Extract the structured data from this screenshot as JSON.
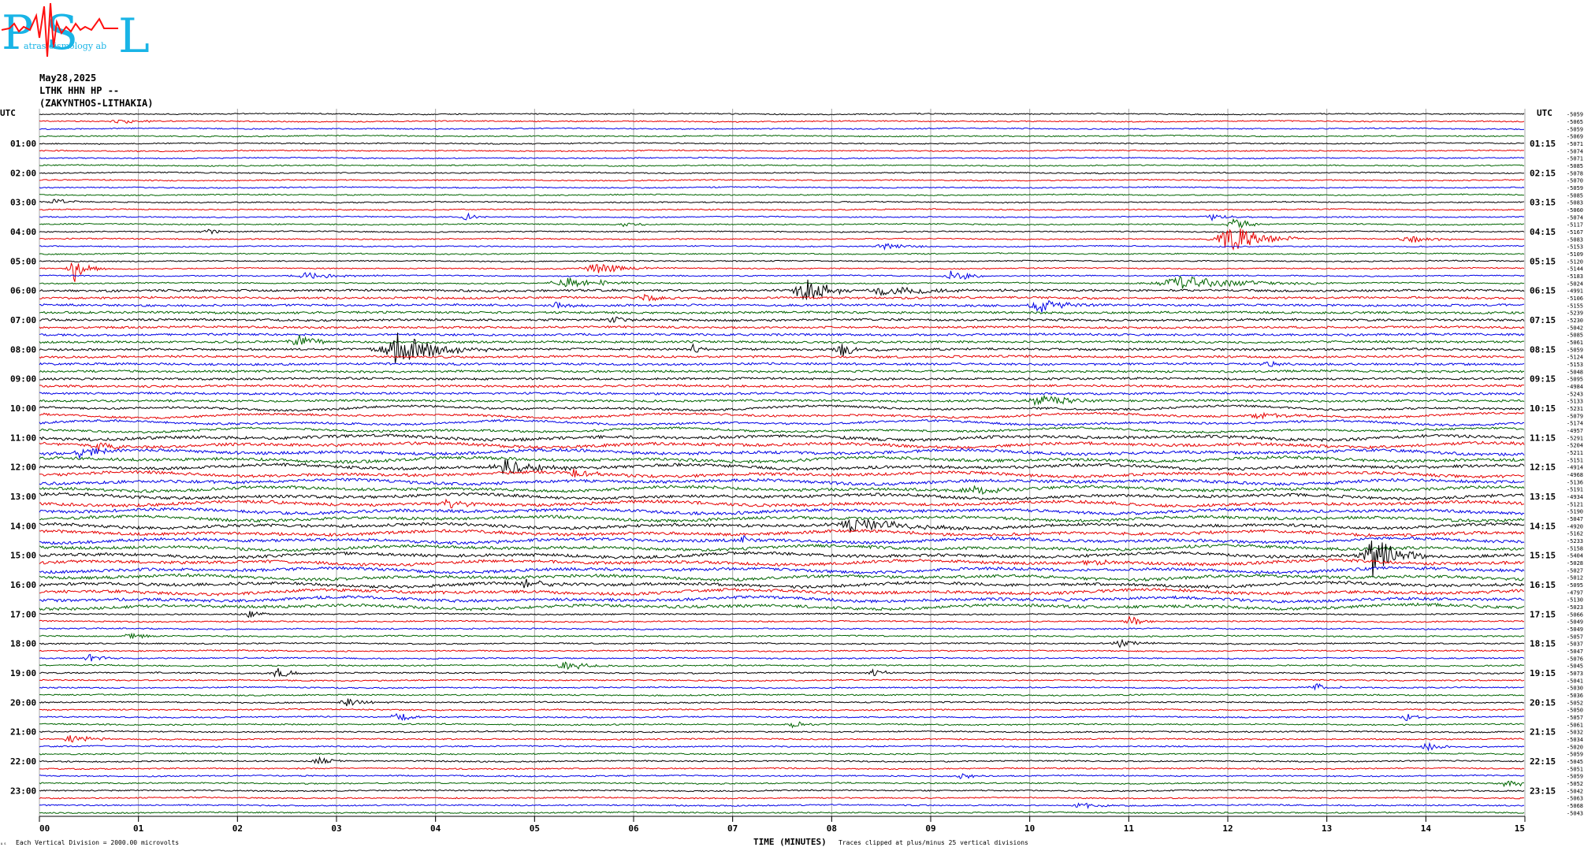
{
  "logo": {
    "letters": [
      "P",
      "S",
      "L"
    ],
    "subtitle": "atras   eismology   ab",
    "colors": {
      "letters": "#19b4e6",
      "trace": "#ff1010"
    }
  },
  "header": {
    "date": "May28,2025",
    "station": "LTHK HHN HP --",
    "location": "(ZAKYNTHOS-LITHAKIA)"
  },
  "axis_corner_labels": {
    "left": "UTC",
    "right": "UTC"
  },
  "footer": {
    "left_mark": "ᵤₛ",
    "division_note": "Each Vertical Division = 2000.00 microvolts",
    "xlabel": "TIME (MINUTES)",
    "clip_note": "Traces clipped at plus/minus 25 vertical divisions"
  },
  "chart_data": {
    "type": "line",
    "title": "LTHK HHN HP --",
    "xlabel": "TIME (MINUTES)",
    "xlim": [
      0,
      15
    ],
    "x_ticks": [
      "00",
      "01",
      "02",
      "03",
      "04",
      "05",
      "06",
      "07",
      "08",
      "09",
      "10",
      "11",
      "12",
      "13",
      "14",
      "15"
    ],
    "row_minutes": 15,
    "row_colors": [
      "#000000",
      "#e60000",
      "#0000e6",
      "#006400"
    ],
    "left_time_labels": [
      "01:00",
      "02:00",
      "03:00",
      "04:00",
      "05:00",
      "06:00",
      "07:00",
      "08:00",
      "09:00",
      "10:00",
      "11:00",
      "12:00",
      "13:00",
      "14:00",
      "15:00",
      "16:00",
      "17:00",
      "18:00",
      "19:00",
      "20:00",
      "21:00",
      "22:00",
      "23:00"
    ],
    "right_time_labels": [
      "01:15",
      "02:15",
      "03:15",
      "04:15",
      "05:15",
      "06:15",
      "07:15",
      "08:15",
      "09:15",
      "10:15",
      "11:15",
      "12:15",
      "13:15",
      "14:15",
      "15:15",
      "16:15",
      "17:15",
      "18:15",
      "19:15",
      "20:15",
      "21:15",
      "22:15",
      "23:15"
    ],
    "row_offsets": [
      "-5059",
      "-5065",
      "-5059",
      "-5069",
      "-5071",
      "-5074",
      "-5071",
      "-5085",
      "-5078",
      "-5070",
      "-5059",
      "-5085",
      "-5083",
      "-5060",
      "-5074",
      "-5117",
      "-5167",
      "-5083",
      "-5153",
      "-5109",
      "-5120",
      "-5144",
      "-5183",
      "-5024",
      "-4991",
      "-5106",
      "-5155",
      "-5239",
      "-5230",
      "-5042",
      "-5085",
      "-5061",
      "-5059",
      "-5124",
      "-5153",
      "-5048",
      "-5095",
      "-4984",
      "-5243",
      "-5133",
      "-5231",
      "-5079",
      "-5174",
      "-4957",
      "-5291",
      "-5204",
      "-5211",
      "-5151",
      "-4914",
      "-4968",
      "-5136",
      "-5191",
      "-4934",
      "-5121",
      "-5190",
      "-5047",
      "-4920",
      "-5162",
      "-5233",
      "-5158",
      "-5404",
      "-5028",
      "-5027",
      "-5012",
      "-5095",
      "-4797",
      "-5130",
      "-5023",
      "-5066",
      "-5049",
      "-5049",
      "-5057",
      "-5037",
      "-5047",
      "-5076",
      "-5045",
      "-5073",
      "-5041",
      "-5030",
      "-5036",
      "-5052",
      "-5050",
      "-5057",
      "-5061",
      "-5032",
      "-5034",
      "-5020",
      "-5059",
      "-5045",
      "-5051",
      "-5059",
      "-5052",
      "-5042",
      "-5063",
      "-5068",
      "-5043"
    ],
    "events": [
      {
        "row": 1,
        "minute": 0.8,
        "amp": 3,
        "dur": 0.6
      },
      {
        "row": 12,
        "minute": 0.15,
        "amp": 5,
        "dur": 0.3
      },
      {
        "row": 14,
        "minute": 11.8,
        "amp": 5,
        "dur": 0.4
      },
      {
        "row": 14,
        "minute": 4.3,
        "amp": 7,
        "dur": 0.2
      },
      {
        "row": 15,
        "minute": 12.05,
        "amp": 8,
        "dur": 0.4
      },
      {
        "row": 15,
        "minute": 5.9,
        "amp": 4,
        "dur": 0.3
      },
      {
        "row": 16,
        "minute": 1.7,
        "amp": 4,
        "dur": 0.3
      },
      {
        "row": 17,
        "minute": 12.0,
        "amp": 22,
        "dur": 0.7
      },
      {
        "row": 17,
        "minute": 13.8,
        "amp": 6,
        "dur": 0.5
      },
      {
        "row": 18,
        "minute": 8.5,
        "amp": 5,
        "dur": 0.5
      },
      {
        "row": 21,
        "minute": 0.35,
        "amp": 18,
        "dur": 0.3
      },
      {
        "row": 21,
        "minute": 5.6,
        "amp": 8,
        "dur": 0.7
      },
      {
        "row": 22,
        "minute": 2.7,
        "amp": 5,
        "dur": 0.8
      },
      {
        "row": 22,
        "minute": 9.2,
        "amp": 9,
        "dur": 0.4
      },
      {
        "row": 23,
        "minute": 5.3,
        "amp": 8,
        "dur": 0.9
      },
      {
        "row": 23,
        "minute": 11.5,
        "amp": 9,
        "dur": 1.5
      },
      {
        "row": 24,
        "minute": 7.7,
        "amp": 22,
        "dur": 0.5
      },
      {
        "row": 24,
        "minute": 8.5,
        "amp": 6,
        "dur": 1.2
      },
      {
        "row": 25,
        "minute": 6.1,
        "amp": 5,
        "dur": 0.4
      },
      {
        "row": 26,
        "minute": 10.1,
        "amp": 9,
        "dur": 0.6
      },
      {
        "row": 26,
        "minute": 5.2,
        "amp": 5,
        "dur": 0.3
      },
      {
        "row": 28,
        "minute": 5.8,
        "amp": 4,
        "dur": 0.5
      },
      {
        "row": 31,
        "minute": 2.6,
        "amp": 9,
        "dur": 0.4
      },
      {
        "row": 32,
        "minute": 3.6,
        "amp": 24,
        "dur": 0.9
      },
      {
        "row": 32,
        "minute": 8.1,
        "amp": 10,
        "dur": 0.4
      },
      {
        "row": 32,
        "minute": 6.6,
        "amp": 6,
        "dur": 0.2
      },
      {
        "row": 34,
        "minute": 12.4,
        "amp": 4,
        "dur": 0.5
      },
      {
        "row": 39,
        "minute": 10.1,
        "amp": 8,
        "dur": 0.8
      },
      {
        "row": 41,
        "minute": 12.3,
        "amp": 5,
        "dur": 0.6
      },
      {
        "row": 45,
        "minute": 0.6,
        "amp": 10,
        "dur": 0.3
      },
      {
        "row": 46,
        "minute": 0.4,
        "amp": 8,
        "dur": 0.5
      },
      {
        "row": 48,
        "minute": 4.7,
        "amp": 11,
        "dur": 0.7
      },
      {
        "row": 49,
        "minute": 5.4,
        "amp": 7,
        "dur": 0.3
      },
      {
        "row": 51,
        "minute": 9.4,
        "amp": 6,
        "dur": 0.6
      },
      {
        "row": 53,
        "minute": 4.1,
        "amp": 7,
        "dur": 0.4
      },
      {
        "row": 56,
        "minute": 8.2,
        "amp": 9,
        "dur": 1.2
      },
      {
        "row": 58,
        "minute": 7.1,
        "amp": 5,
        "dur": 0.3
      },
      {
        "row": 60,
        "minute": 13.45,
        "amp": 32,
        "dur": 0.5
      },
      {
        "row": 61,
        "minute": 10.6,
        "amp": 5,
        "dur": 0.3
      },
      {
        "row": 64,
        "minute": 4.9,
        "amp": 5,
        "dur": 0.6
      },
      {
        "row": 68,
        "minute": 2.1,
        "amp": 5,
        "dur": 0.3
      },
      {
        "row": 69,
        "minute": 11.0,
        "amp": 7,
        "dur": 0.3
      },
      {
        "row": 71,
        "minute": 0.9,
        "amp": 6,
        "dur": 0.3
      },
      {
        "row": 72,
        "minute": 10.9,
        "amp": 6,
        "dur": 0.4
      },
      {
        "row": 74,
        "minute": 0.5,
        "amp": 5,
        "dur": 0.3
      },
      {
        "row": 75,
        "minute": 5.3,
        "amp": 7,
        "dur": 0.5
      },
      {
        "row": 76,
        "minute": 2.4,
        "amp": 8,
        "dur": 0.3
      },
      {
        "row": 76,
        "minute": 8.4,
        "amp": 6,
        "dur": 0.3
      },
      {
        "row": 78,
        "minute": 12.9,
        "amp": 5,
        "dur": 0.4
      },
      {
        "row": 80,
        "minute": 3.1,
        "amp": 5,
        "dur": 0.5
      },
      {
        "row": 82,
        "minute": 3.6,
        "amp": 8,
        "dur": 0.3
      },
      {
        "row": 82,
        "minute": 13.8,
        "amp": 6,
        "dur": 0.3
      },
      {
        "row": 83,
        "minute": 7.6,
        "amp": 6,
        "dur": 0.3
      },
      {
        "row": 85,
        "minute": 0.3,
        "amp": 6,
        "dur": 0.5
      },
      {
        "row": 86,
        "minute": 14.0,
        "amp": 7,
        "dur": 0.3
      },
      {
        "row": 88,
        "minute": 2.8,
        "amp": 5,
        "dur": 0.4
      },
      {
        "row": 90,
        "minute": 9.3,
        "amp": 5,
        "dur": 0.3
      },
      {
        "row": 91,
        "minute": 14.8,
        "amp": 7,
        "dur": 0.3
      },
      {
        "row": 94,
        "minute": 10.5,
        "amp": 4,
        "dur": 0.5
      }
    ]
  }
}
